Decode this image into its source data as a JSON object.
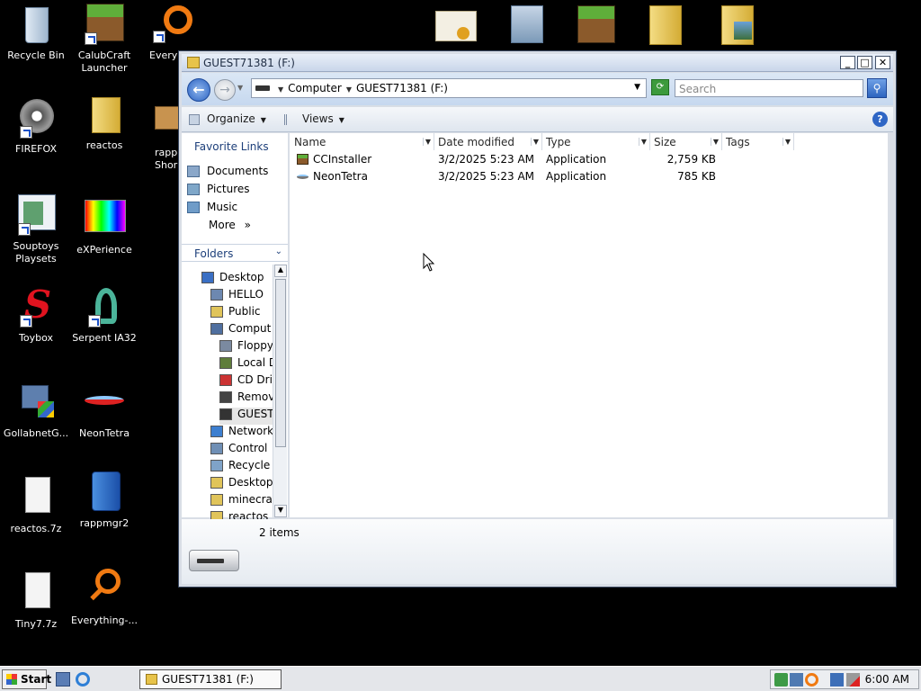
{
  "desktop": {
    "icons": [
      {
        "label": "Recycle Bin"
      },
      {
        "label": "CalubCraft Launcher"
      },
      {
        "label": "Every"
      },
      {
        "label": "FIREFOX"
      },
      {
        "label": "reactos"
      },
      {
        "label": "rapp Shor"
      },
      {
        "label": "Souptoys Playsets"
      },
      {
        "label": "eXPerience"
      },
      {
        "label": "Toybox"
      },
      {
        "label": "Serpent IA32"
      },
      {
        "label": "GollabnetG..."
      },
      {
        "label": "NeonTetra"
      },
      {
        "label": "reactos.7z"
      },
      {
        "label": "rappmgr2"
      },
      {
        "label": "Tiny7.7z"
      },
      {
        "label": "Everything-..."
      }
    ]
  },
  "window": {
    "title": "GUEST71381 (F:)",
    "controls": {
      "minimize": "_",
      "maximize": "□",
      "close": "✕"
    },
    "address": {
      "crumbs": [
        "Computer",
        "GUEST71381 (F:)"
      ]
    },
    "search": {
      "placeholder": "Search"
    },
    "toolbar": {
      "organize": "Organize",
      "views": "Views",
      "help": "?"
    },
    "favorites": {
      "heading": "Favorite Links",
      "items": [
        "Documents",
        "Pictures",
        "Music"
      ],
      "more": "More",
      "more_glyph": "»"
    },
    "folders": {
      "heading": "Folders",
      "tree": [
        {
          "label": "Desktop",
          "level": 0
        },
        {
          "label": "HELLO",
          "level": 1
        },
        {
          "label": "Public",
          "level": 1
        },
        {
          "label": "Comput",
          "level": 1
        },
        {
          "label": "Floppy",
          "level": 2
        },
        {
          "label": "Local D",
          "level": 2
        },
        {
          "label": "CD Dri",
          "level": 2
        },
        {
          "label": "Remov",
          "level": 2
        },
        {
          "label": "GUEST",
          "level": 2
        },
        {
          "label": "Network",
          "level": 1
        },
        {
          "label": "Control",
          "level": 1
        },
        {
          "label": "Recycle",
          "level": 1
        },
        {
          "label": "Desktop",
          "level": 1
        },
        {
          "label": "minecra",
          "level": 1
        },
        {
          "label": "reactos",
          "level": 1
        }
      ]
    },
    "columns": [
      "Name",
      "Date modified",
      "Type",
      "Size",
      "Tags"
    ],
    "files": [
      {
        "name": "CCInstaller",
        "date": "3/2/2025 5:23 AM",
        "type": "Application",
        "size": "2,759 KB"
      },
      {
        "name": "NeonTetra",
        "date": "3/2/2025 5:23 AM",
        "type": "Application",
        "size": "785 KB"
      }
    ],
    "status": {
      "count": "2 items"
    }
  },
  "taskbar": {
    "start": "Start",
    "task": "GUEST71381 (F:)",
    "clock": "6:00 AM"
  },
  "colors": {
    "accent": "#2b62c2",
    "window_frame": "#3b4a63"
  }
}
